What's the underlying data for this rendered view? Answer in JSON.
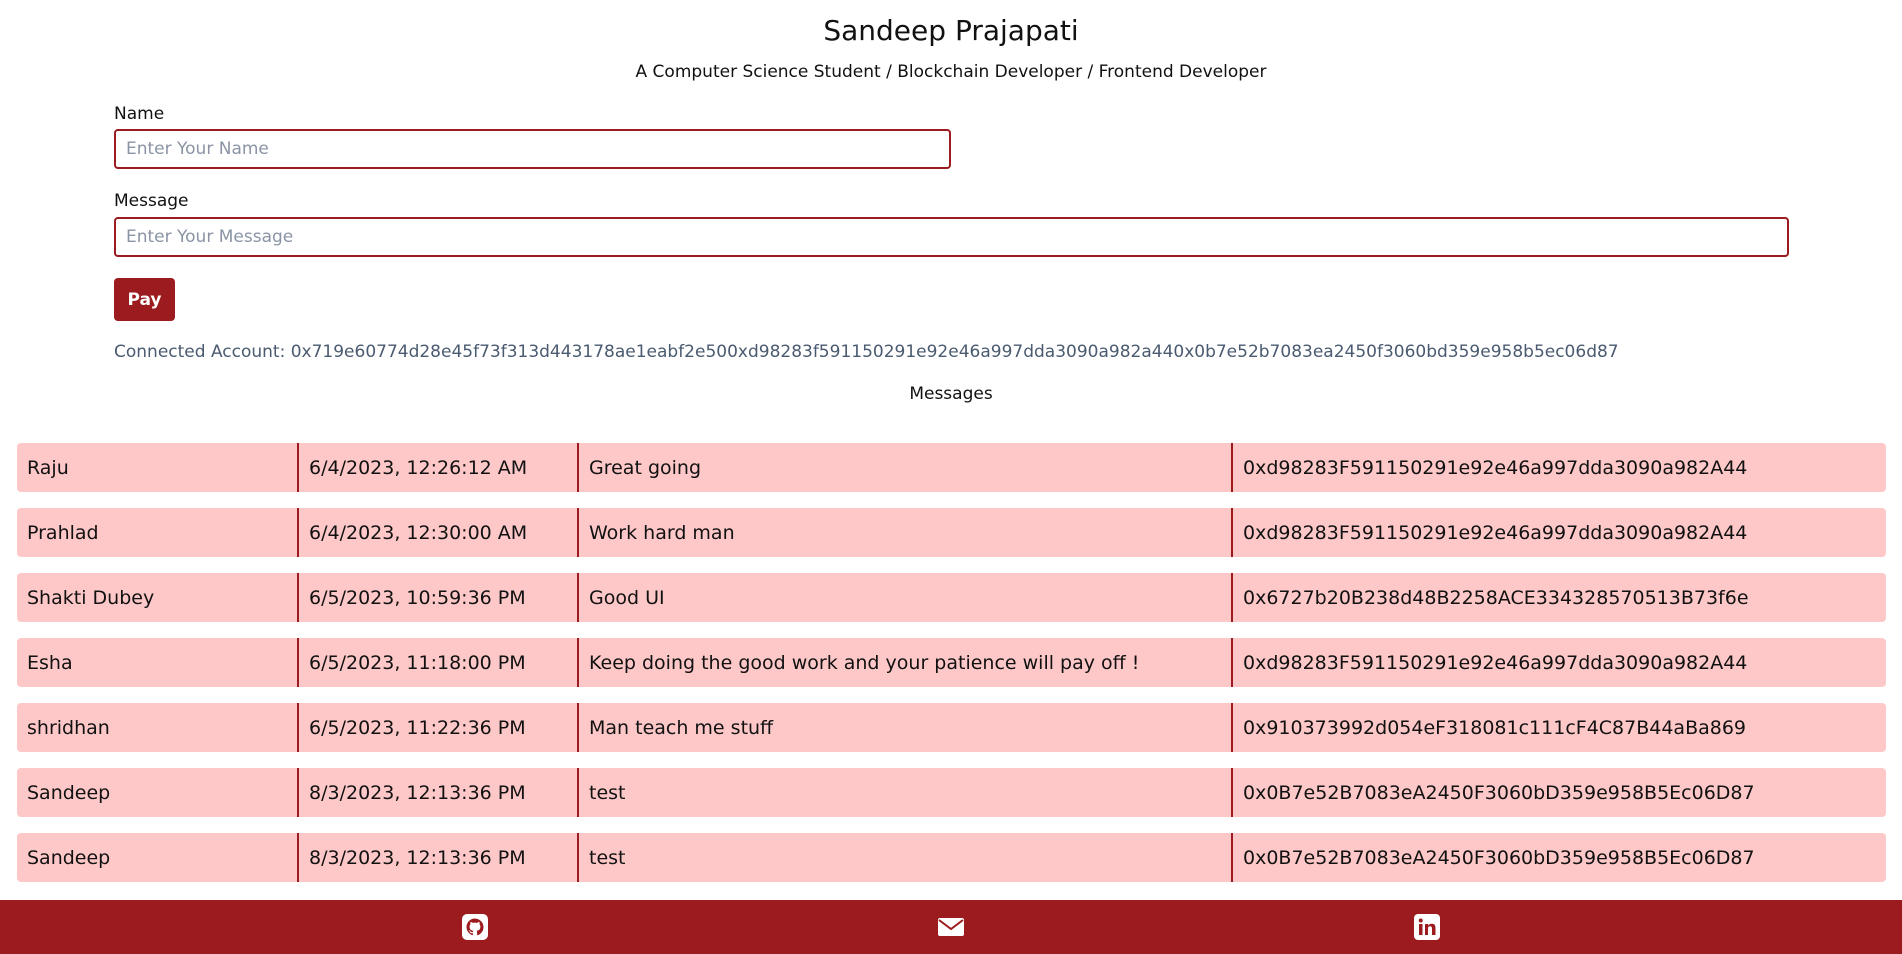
{
  "header": {
    "title": "Sandeep Prajapati",
    "subtitle": "A Computer Science Student / Blockchain Developer / Frontend Developer"
  },
  "form": {
    "name_label": "Name",
    "name_placeholder": "Enter Your Name",
    "name_value": "",
    "message_label": "Message",
    "message_placeholder": "Enter Your Message",
    "message_value": "",
    "pay_label": "Pay"
  },
  "connected_account": "Connected Account: 0x719e60774d28e45f73f313d443178ae1eabf2e500xd98283f591150291e92e46a997dda3090a982a440x0b7e52b7083ea2450f3060bd359e958b5ec06d87",
  "messages": {
    "heading": "Messages",
    "rows": [
      {
        "name": "Raju",
        "timestamp": "6/4/2023, 12:26:12 AM",
        "message": "Great going",
        "address": "0xd98283F591150291e92e46a997dda3090a982A44"
      },
      {
        "name": "Prahlad",
        "timestamp": "6/4/2023, 12:30:00 AM",
        "message": "Work hard man",
        "address": "0xd98283F591150291e92e46a997dda3090a982A44"
      },
      {
        "name": "Shakti Dubey",
        "timestamp": "6/5/2023, 10:59:36 PM",
        "message": "Good UI",
        "address": "0x6727b20B238d48B2258ACE334328570513B73f6e"
      },
      {
        "name": "Esha",
        "timestamp": "6/5/2023, 11:18:00 PM",
        "message": "Keep doing the good work and your patience will pay off !",
        "address": "0xd98283F591150291e92e46a997dda3090a982A44"
      },
      {
        "name": "shridhan",
        "timestamp": "6/5/2023, 11:22:36 PM",
        "message": "Man teach me stuff",
        "address": "0x910373992d054eF318081c111cF4C87B44aBa869"
      },
      {
        "name": "Sandeep",
        "timestamp": "8/3/2023, 12:13:36 PM",
        "message": "test",
        "address": "0x0B7e52B7083eA2450F3060bD359e958B5Ec06D87"
      },
      {
        "name": "Sandeep",
        "timestamp": "8/3/2023, 12:13:36 PM",
        "message": "test",
        "address": "0x0B7e52B7083eA2450F3060bD359e958B5Ec06D87"
      }
    ]
  },
  "footer": {
    "icons": [
      "github-icon",
      "mail-icon",
      "linkedin-icon"
    ]
  },
  "colors": {
    "accent": "#9b1b1e",
    "row_background": "#fec8c8",
    "muted_text": "#4a5a70"
  }
}
